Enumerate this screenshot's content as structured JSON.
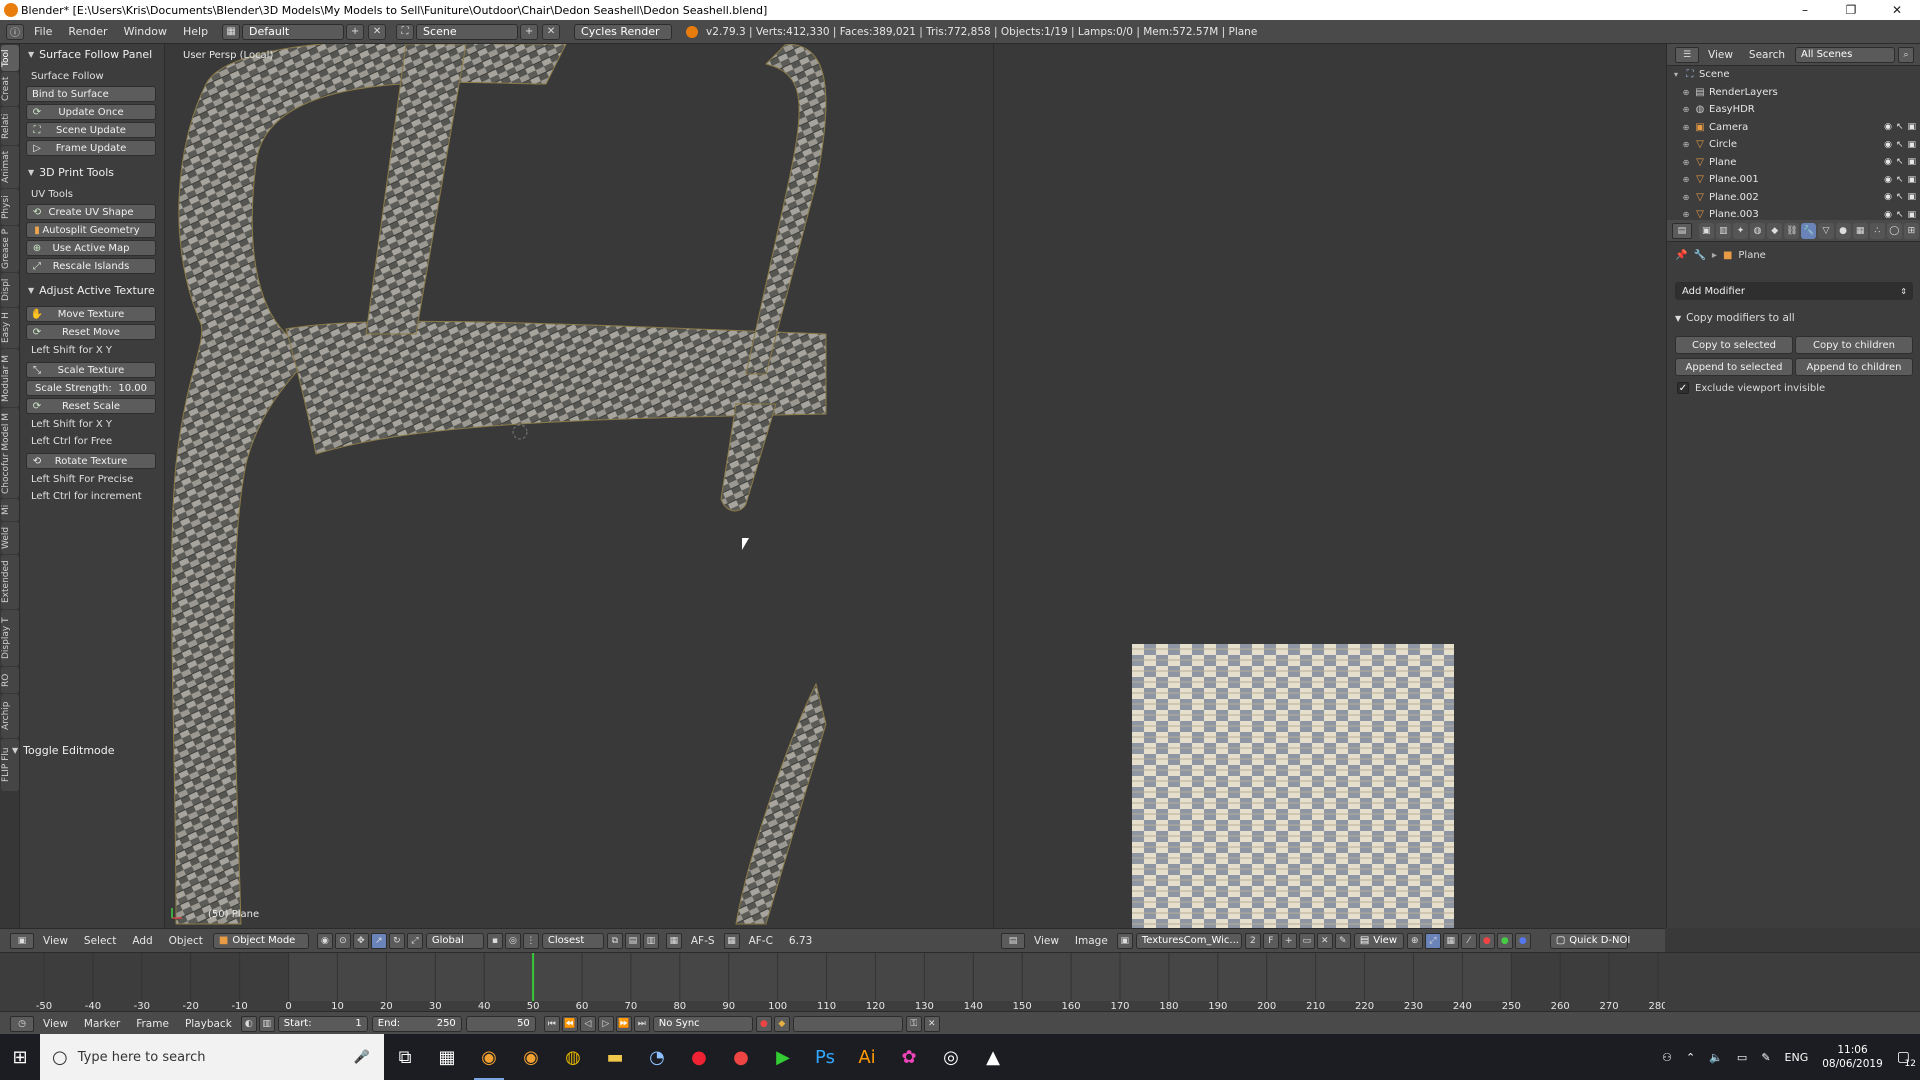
{
  "window": {
    "title": "Blender* [E:\\Users\\Kris\\Documents\\Blender\\3D Models\\My Models to Sell\\Funiture\\Outdoor\\Chair\\Dedon Seashell\\Dedon Seashell.blend]",
    "controls": [
      "–",
      "❐",
      "✕"
    ]
  },
  "info_header": {
    "menus": [
      "File",
      "Render",
      "Window",
      "Help"
    ],
    "layout": "Default",
    "scene": "Scene",
    "render_engine": "Cycles Render",
    "stats": "v2.79.3 | Verts:412,330 | Faces:389,021 | Tris:772,858 | Objects:1/19 | Lamps:0/0 | Mem:572.57M | Plane"
  },
  "tab_strip": [
    "Tool",
    "Creat",
    "Relati",
    "Animat",
    "Physi",
    "Grease P",
    "Displ",
    "Easy H",
    "Modular M",
    "Chocofur Model M",
    "Mi",
    "Weld",
    "Extended",
    "Display T",
    "RO",
    "Archip",
    "FLIP Flu"
  ],
  "tool_shelf": {
    "surface_follow": {
      "header": "Surface Follow Panel",
      "label": "Surface Follow",
      "bind_button": "Bind to Surface",
      "buttons": [
        "Update Once",
        "Scene Update",
        "Frame Update"
      ]
    },
    "print_tools": {
      "header": "3D Print Tools",
      "label": "UV Tools",
      "buttons": [
        "Create UV Shape",
        "Autosplit Geometry",
        "Use Active Map",
        "Rescale Islands"
      ]
    },
    "adjust_texture": {
      "header": "Adjust Active Texture",
      "move_button": "Move Texture",
      "reset_move_button": "Reset Move",
      "hint_move": "Left Shift for X Y",
      "scale_button": "Scale Texture",
      "scale_strength_label": "Scale Strength:",
      "scale_strength_value": "10.00",
      "reset_scale_button": "Reset Scale",
      "hint_scale_1": "Left Shift for X Y",
      "hint_scale_2": "Left Ctrl for Free",
      "rotate_button": "Rotate Texture",
      "hint_rotate_1": "Left Shift For Precise",
      "hint_rotate_2": "Left Ctrl for increment"
    },
    "toggle_editmode": "Toggle Editmode"
  },
  "viewport": {
    "label": "User Persp (Local)",
    "object_label": "(50) Plane",
    "header": {
      "menus": [
        "View",
        "Select",
        "Add",
        "Object"
      ],
      "mode": "Object Mode",
      "orientation": "Global",
      "snap": "Closest",
      "af_s": "AF-S",
      "af_c": "AF-C",
      "value": "6.73"
    }
  },
  "uv_editor": {
    "header": {
      "menus": [
        "View",
        "Image"
      ],
      "image_name": "TexturesCom_Wic...",
      "users": "2",
      "fake": "F",
      "view_menu": "View",
      "quick": "Quick D-NOI"
    }
  },
  "outliner": {
    "view_label": "View",
    "search_label": "Search",
    "filter": "All Scenes",
    "items": [
      {
        "name": "Scene",
        "icon": "scene-icon",
        "color": "#9fb4d6"
      },
      {
        "name": "RenderLayers",
        "icon": "renderlayers-icon",
        "color": "#c9c9c9"
      },
      {
        "name": "EasyHDR",
        "icon": "world-icon",
        "color": "#c9c9c9"
      },
      {
        "name": "Camera",
        "icon": "camera-icon",
        "color": "#e89b45"
      },
      {
        "name": "Circle",
        "icon": "mesh-icon",
        "color": "#e89b45"
      },
      {
        "name": "Plane",
        "icon": "mesh-icon",
        "color": "#e89b45"
      },
      {
        "name": "Plane.001",
        "icon": "mesh-icon",
        "color": "#e89b45"
      },
      {
        "name": "Plane.002",
        "icon": "mesh-icon",
        "color": "#e89b45"
      },
      {
        "name": "Plane.003",
        "icon": "mesh-icon",
        "color": "#e89b45"
      }
    ]
  },
  "properties": {
    "object_name": "Plane",
    "add_modifier": "Add Modifier",
    "copy_panel_header": "Copy modifiers to all",
    "buttons": [
      "Copy to selected",
      "Copy to children",
      "Append to selected",
      "Append to children"
    ],
    "exclude_label": "Exclude viewport invisible",
    "exclude_checked": true
  },
  "timeline": {
    "ticks": [
      "-50",
      "-40",
      "-30",
      "-20",
      "-10",
      "0",
      "10",
      "20",
      "30",
      "40",
      "50",
      "60",
      "70",
      "80",
      "90",
      "100",
      "110",
      "120",
      "130",
      "140",
      "150",
      "160",
      "170",
      "180",
      "190",
      "200",
      "210",
      "220",
      "230",
      "240",
      "250",
      "260",
      "270",
      "280"
    ],
    "current_frame": 50,
    "frame_start": 0,
    "frame_end": 250,
    "header": {
      "menus": [
        "View",
        "Marker",
        "Frame",
        "Playback"
      ],
      "start_label": "Start:",
      "start_value": "1",
      "end_label": "End:",
      "end_value": "250",
      "current_value": "50",
      "sync": "No Sync"
    }
  },
  "taskbar": {
    "search_placeholder": "Type here to search",
    "language": "ENG",
    "time": "11:06",
    "date": "08/06/2019",
    "notifications": "12"
  },
  "colors": {
    "accent_blue": "#6a83b8",
    "playhead": "#37c837",
    "object_orange": "#e89b45",
    "taskbar_bg": "#1c1d22"
  }
}
